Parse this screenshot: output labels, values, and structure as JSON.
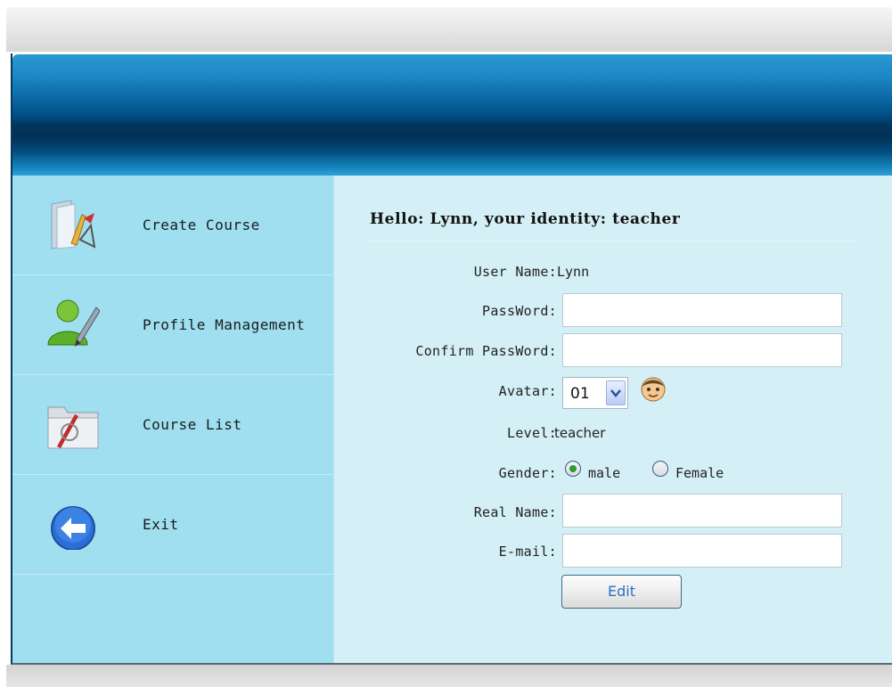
{
  "sidebar": {
    "items": [
      {
        "label": "Create Course",
        "icon": "create-course-icon"
      },
      {
        "label": "Profile Management",
        "icon": "profile-user-icon"
      },
      {
        "label": "Course List",
        "icon": "folder-list-icon"
      },
      {
        "label": "Exit",
        "icon": "back-arrow-icon"
      }
    ]
  },
  "main": {
    "greeting": "Hello: Lynn, your identity: teacher",
    "form": {
      "user_name_label": "User Name:",
      "user_name_value": "Lynn",
      "password_label": "PassWord:",
      "password_value": "",
      "confirm_password_label": "Confirm PassWord:",
      "confirm_password_value": "",
      "avatar_label": "Avatar:",
      "avatar_selected": "01",
      "level_label": "Level:",
      "level_value": "teacher",
      "gender_label": "Gender:",
      "gender_options": [
        "male",
        "Female"
      ],
      "gender_selected": "male",
      "real_name_label": "Real Name:",
      "real_name_value": "",
      "email_label": "E-mail:",
      "email_value": "",
      "edit_label": "Edit"
    }
  },
  "colors": {
    "banner": "#024f86",
    "sidebar": "#9fdff0",
    "content": "#d4eff5",
    "button_text": "#2b6fc1"
  }
}
